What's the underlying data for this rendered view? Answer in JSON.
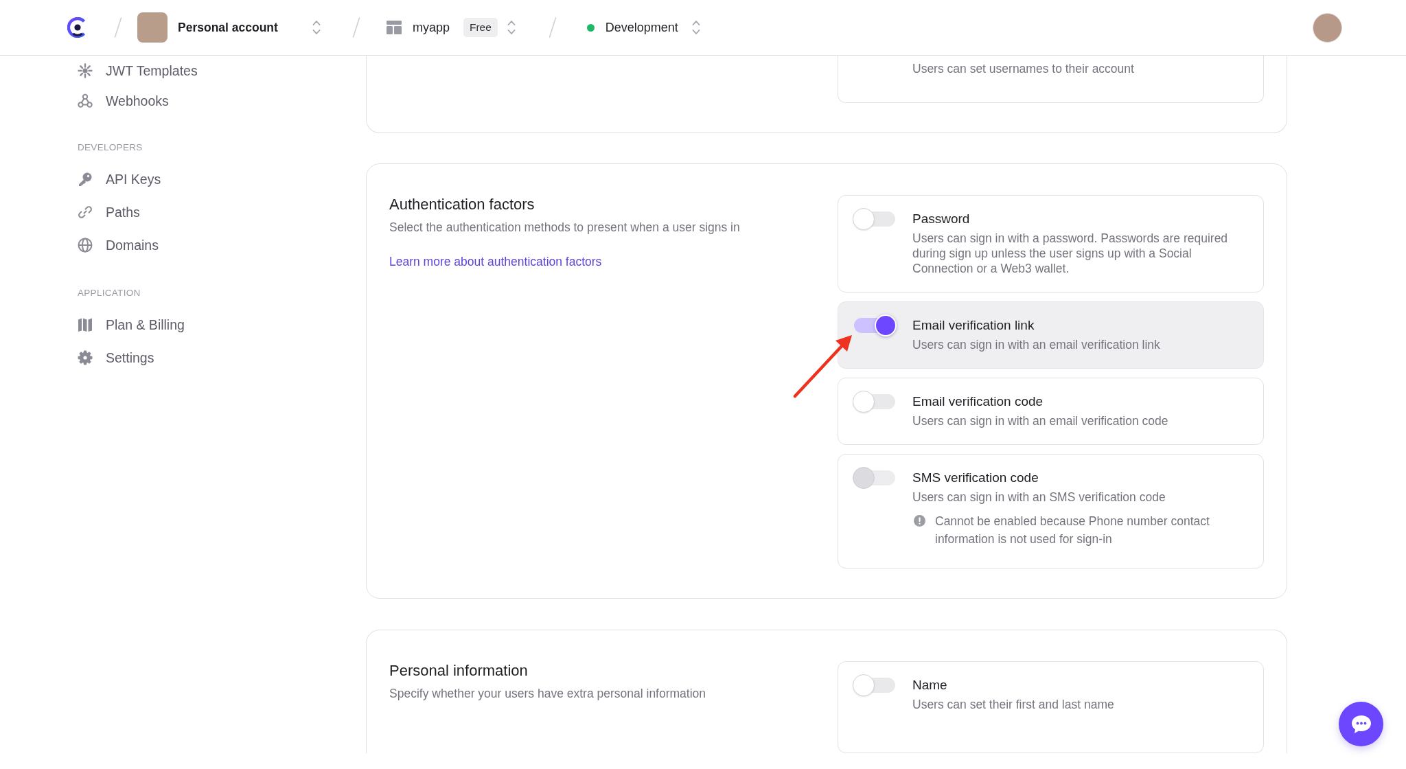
{
  "topbar": {
    "breadcrumbs": [
      {
        "kind": "account",
        "label": "Personal account"
      },
      {
        "kind": "app",
        "label": "myapp",
        "badge": "Free"
      },
      {
        "kind": "environment",
        "label": "Development"
      }
    ]
  },
  "sidebar": {
    "sections": [
      {
        "items": [
          "JWT Templates",
          "Webhooks"
        ]
      },
      {
        "heading": "DEVELOPERS",
        "items": [
          "API Keys",
          "Paths",
          "Domains"
        ]
      },
      {
        "heading": "APPLICATION",
        "items": [
          "Plan & Billing",
          "Settings"
        ]
      }
    ]
  },
  "sections": [
    {
      "options": [
        {
          "description": "Users can set usernames to their account"
        }
      ]
    },
    {
      "title": "Authentication factors",
      "description": "Select the authentication methods to present when a user signs in",
      "link": "Learn more about authentication factors",
      "options": [
        {
          "title": "Password",
          "description": "Users can sign in with a password. Passwords are required during sign up unless the user signs up with a Social Connection or a Web3 wallet.",
          "on": false,
          "disabled": false,
          "highlighted": false
        },
        {
          "title": "Email verification link",
          "description": "Users can sign in with an email verification link",
          "on": true,
          "disabled": false,
          "highlighted": true
        },
        {
          "title": "Email verification code",
          "description": "Users can sign in with an email verification code",
          "on": false,
          "disabled": false,
          "highlighted": false
        },
        {
          "title": "SMS verification code",
          "description": "Users can sign in with an SMS verification code",
          "on": false,
          "disabled": true,
          "highlighted": false,
          "note": "Cannot be enabled because Phone number contact information is not used for sign-in"
        }
      ]
    },
    {
      "title": "Personal information",
      "description": "Specify whether your users have extra personal information",
      "options": [
        {
          "title": "Name",
          "description": "Users can set their first and last name",
          "on": false,
          "disabled": false,
          "highlighted": false
        }
      ]
    }
  ]
}
